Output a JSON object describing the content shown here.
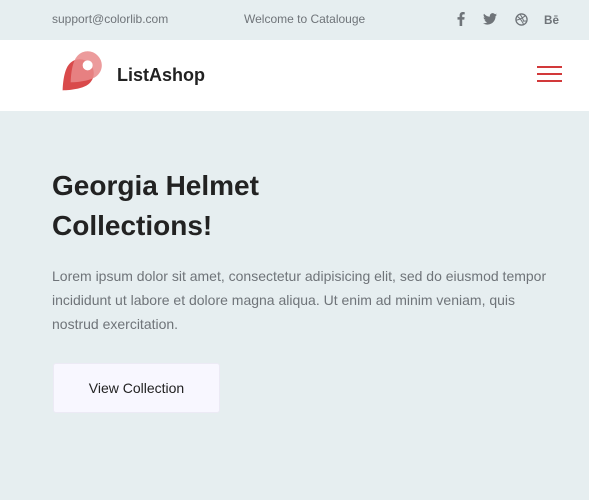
{
  "topbar": {
    "email": "support@colorlib.com",
    "welcome": "Welcome to Catalouge",
    "social": [
      {
        "icon": "facebook-icon"
      },
      {
        "icon": "twitter-icon"
      },
      {
        "icon": "dribbble-icon"
      },
      {
        "icon": "behance-icon"
      }
    ]
  },
  "navbar": {
    "brand": "ListAshop",
    "logo_icon": "map-pin-logo-icon",
    "menu_icon": "hamburger-menu-icon"
  },
  "hero": {
    "title_line1": "Georgia Helmet",
    "title_line2": "Collections!",
    "text": "Lorem ipsum dolor sit amet, consectetur adipisicing elit, sed do eiusmod tempor incididunt ut labore et dolore magna aliqua. Ut enim ad minim veniam, quis nostrud exercitation.",
    "button_label": "View Collection"
  },
  "colors": {
    "accent": "#d2393a",
    "background": "#e6eef0",
    "text": "#222222",
    "muted": "#6f7479"
  }
}
